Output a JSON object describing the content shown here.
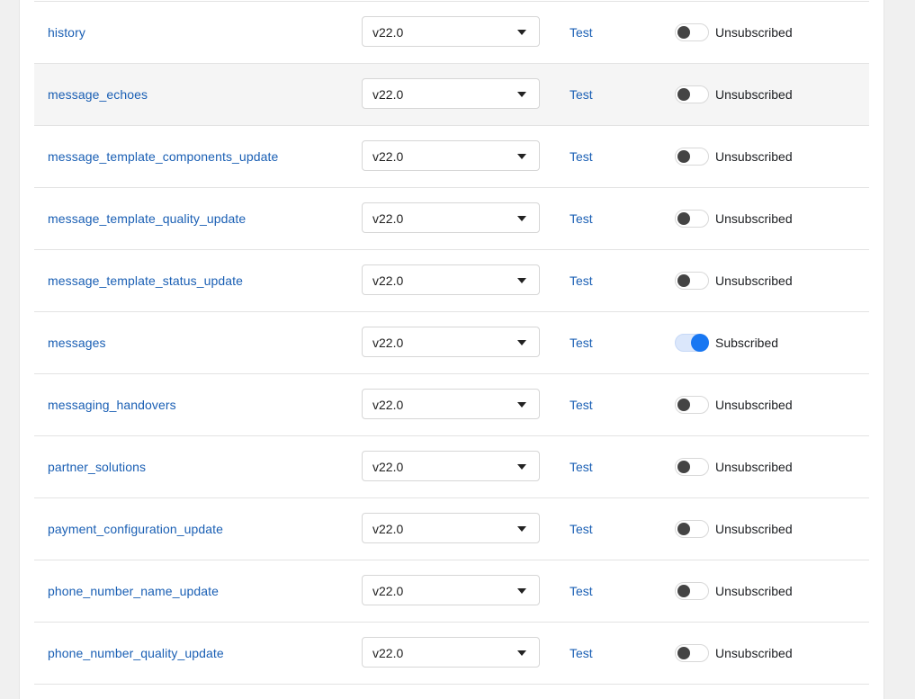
{
  "webhook_fields": [
    {
      "name": "history",
      "version": "v22.0",
      "test_label": "Test",
      "subscribed": false,
      "status": "Unsubscribed"
    },
    {
      "name": "message_echoes",
      "version": "v22.0",
      "test_label": "Test",
      "subscribed": false,
      "status": "Unsubscribed",
      "hover": true
    },
    {
      "name": "message_template_components_update",
      "version": "v22.0",
      "test_label": "Test",
      "subscribed": false,
      "status": "Unsubscribed"
    },
    {
      "name": "message_template_quality_update",
      "version": "v22.0",
      "test_label": "Test",
      "subscribed": false,
      "status": "Unsubscribed"
    },
    {
      "name": "message_template_status_update",
      "version": "v22.0",
      "test_label": "Test",
      "subscribed": false,
      "status": "Unsubscribed"
    },
    {
      "name": "messages",
      "version": "v22.0",
      "test_label": "Test",
      "subscribed": true,
      "status": "Subscribed"
    },
    {
      "name": "messaging_handovers",
      "version": "v22.0",
      "test_label": "Test",
      "subscribed": false,
      "status": "Unsubscribed"
    },
    {
      "name": "partner_solutions",
      "version": "v22.0",
      "test_label": "Test",
      "subscribed": false,
      "status": "Unsubscribed"
    },
    {
      "name": "payment_configuration_update",
      "version": "v22.0",
      "test_label": "Test",
      "subscribed": false,
      "status": "Unsubscribed"
    },
    {
      "name": "phone_number_name_update",
      "version": "v22.0",
      "test_label": "Test",
      "subscribed": false,
      "status": "Unsubscribed"
    },
    {
      "name": "phone_number_quality_update",
      "version": "v22.0",
      "test_label": "Test",
      "subscribed": false,
      "status": "Unsubscribed"
    }
  ],
  "colors": {
    "link": "#1a5fb4",
    "toggle_on": "#1877f2",
    "toggle_off_knob": "#444444",
    "row_hover": "#f5f5f5",
    "divider": "#e3e3e3"
  },
  "icons": {
    "select_caret": "caret-down-icon"
  }
}
